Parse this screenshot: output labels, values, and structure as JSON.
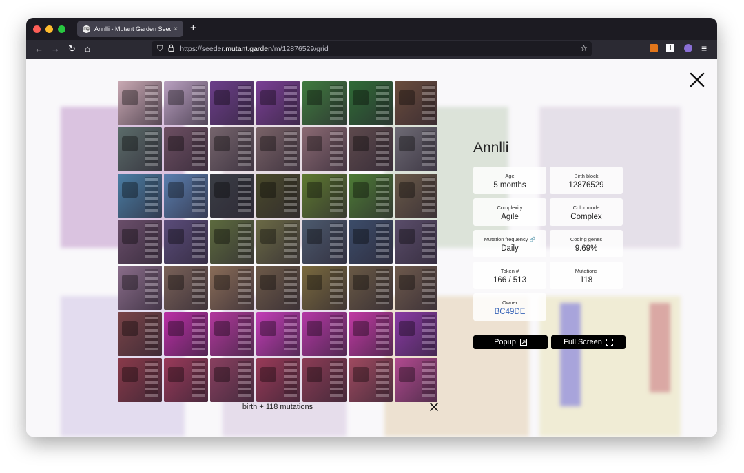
{
  "browser": {
    "tab_title": "Annlli - Mutant Garden Seeder",
    "tab_favicon": "mg",
    "url_prefix": "https://seeder.",
    "url_domain": "mutant.garden",
    "url_path": "/m/12876529/grid"
  },
  "icons": {
    "back": "←",
    "forward": "→",
    "reload": "↻",
    "home": "⌂",
    "shield": "⛉",
    "lock": "🔒",
    "star": "☆",
    "menu": "≡",
    "tab_close": "×",
    "new_tab": "+"
  },
  "seed": {
    "name": "Annlli",
    "stats": [
      {
        "key": "Age",
        "value": "5 months"
      },
      {
        "key": "Birth block",
        "value": "12876529"
      },
      {
        "key": "Complexity",
        "value": "Agile"
      },
      {
        "key": "Color mode",
        "value": "Complex"
      },
      {
        "key": "Mutation frequency",
        "value": "Daily",
        "key_icon": "🔗"
      },
      {
        "key": "Coding genes",
        "value": "9.69%"
      },
      {
        "key": "Token #",
        "value": "166 / 513"
      },
      {
        "key": "Mutations",
        "value": "118"
      },
      {
        "key": "Owner",
        "value": "BC49DE"
      }
    ],
    "popup_label": "Popup",
    "fullscreen_label": "Full Screen"
  },
  "grid": {
    "caption": "birth + 118 mutations",
    "row_colors": [
      [
        "#c9a9b3",
        "#b9a0c0",
        "#6c3e8a",
        "#7a3f95",
        "#3f7b3e",
        "#2f6c36",
        "#6a4c3c"
      ],
      [
        "#5b6c6a",
        "#6d4f62",
        "#76656d",
        "#7a6368",
        "#8b6a73",
        "#5e4a4d",
        "#6e6b75"
      ],
      [
        "#4a7ea5",
        "#5a7fb0",
        "#3a3e45",
        "#4a4a2a",
        "#5e7a30",
        "#4d7c35",
        "#6a5a48"
      ],
      [
        "#6a4e6a",
        "#5a4c7a",
        "#5d6b3e",
        "#6b6a45",
        "#4c5a6e",
        "#3c4d6a",
        "#5a4d6a"
      ],
      [
        "#8a6d8a",
        "#7a6258",
        "#8a6d58",
        "#6d5a48",
        "#7a6a3e",
        "#6a5a45",
        "#6e5a4c"
      ],
      [
        "#7a4448",
        "#bb2fa7",
        "#b3399e",
        "#c43db8",
        "#b538a6",
        "#c23aa5",
        "#8a3aa5"
      ],
      [
        "#8a3a4a",
        "#9a3a5a",
        "#8a4060",
        "#9a3a58",
        "#8c3c55",
        "#a04a60",
        "#b24a90"
      ],
      [
        "#8a7a3e",
        "#8a7a40",
        "#7a7040",
        "#8a7a50",
        "#7a6a40",
        "#8a7048",
        "#7a6a4a"
      ]
    ]
  }
}
